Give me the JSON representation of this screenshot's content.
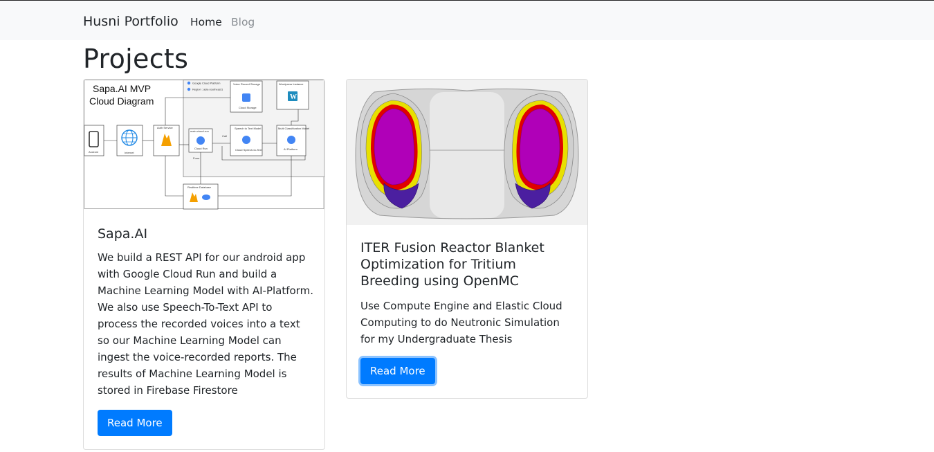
{
  "navbar": {
    "brand": "Husni Portfolio",
    "links": [
      {
        "label": "Home",
        "active": true
      },
      {
        "label": "Blog",
        "active": false
      }
    ]
  },
  "page": {
    "title": "Projects"
  },
  "projects": [
    {
      "title": "Sapa.AI",
      "description": "We build a REST API for our android app with Google Cloud Run and build a Machine Learning Model with AI-Platform. We also use Speech-To-Text API to process the recorded voices into a text so our Machine Learning Model can ingest the voice-recorded reports. The results of Machine Learning Model is stored in Firebase Firestore",
      "button_label": "Read More",
      "diagram": {
        "title_line1": "Sapa.AI MVP",
        "title_line2": "Cloud Diagram",
        "gcp_label": "Google Cloud Platform",
        "region_label": "Region : asia-southeast1",
        "nodes": {
          "android": "Android",
          "internet": "Internet",
          "auth": "Auth Service",
          "cloud_run": "main-cloud-run",
          "cloud_run_sub": "Cloud Run",
          "voice_storage": "Voice Record Storage",
          "voice_storage_sub": "Cloud Storage",
          "wordpress": "Wordpress Instance",
          "speech": "Speech to Text Model",
          "speech_sub": "Cloud Speech-to-Text",
          "multi_class": "Multi Classification Model",
          "multi_class_sub": "AI Platform",
          "realtime_db": "Realtime Database",
          "call": "Call",
          "form": "Form"
        }
      }
    },
    {
      "title": "ITER Fusion Reactor Blanket Optimization for Tritium Breeding using OpenMC",
      "description": "Use Compute Engine and Elastic Cloud Computing to do Neutronic Simulation for my Undergraduate Thesis",
      "button_label": "Read More"
    }
  ],
  "colors": {
    "primary": "#007bff",
    "navbar_bg": "#f8f9fa",
    "plasma": "#b000b8",
    "blanket_red": "#e00000",
    "blanket_yellow": "#e8e000",
    "divertor": "#4b1fa0"
  },
  "icons": [
    "phone-icon",
    "globe-icon",
    "firebase-icon",
    "cloud-run-icon",
    "cloud-storage-icon",
    "wordpress-icon",
    "speech-icon",
    "ai-platform-icon",
    "database-icon"
  ]
}
